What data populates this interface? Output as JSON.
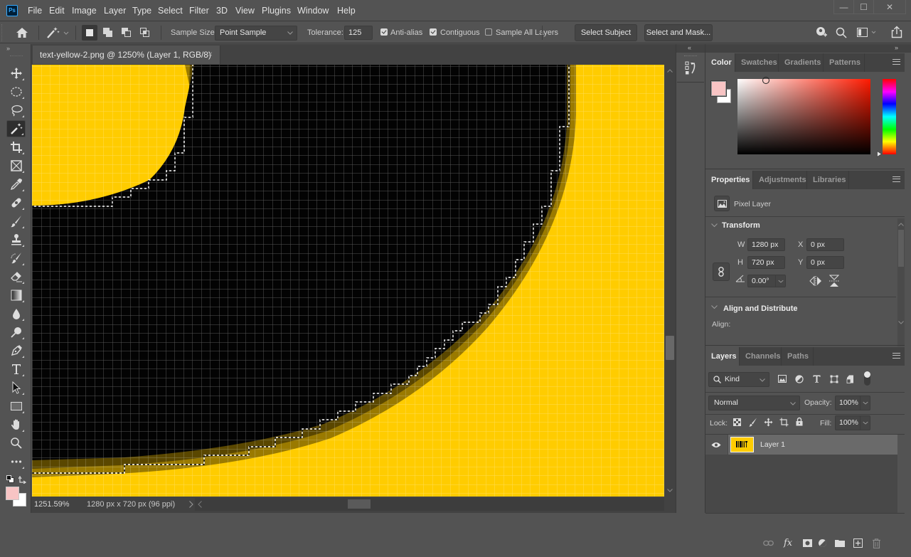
{
  "app": {
    "logo": "Ps"
  },
  "menu": [
    "File",
    "Edit",
    "Image",
    "Layer",
    "Type",
    "Select",
    "Filter",
    "3D",
    "View",
    "Plugins",
    "Window",
    "Help"
  ],
  "window_controls": {
    "minimize": "—",
    "maximize": "☐",
    "close": "✕"
  },
  "options_bar": {
    "sample_size_label": "Sample Size:",
    "sample_size_value": "Point Sample",
    "tolerance_label": "Tolerance:",
    "tolerance_value": "125",
    "anti_alias_label": "Anti-alias",
    "anti_alias_checked": true,
    "contiguous_label": "Contiguous",
    "contiguous_checked": true,
    "sample_all_layers_label": "Sample All Layers",
    "sample_all_layers_checked": false,
    "select_subject_label": "Select Subject",
    "select_and_mask_label": "Select and Mask...",
    "selection_modes": [
      "new-selection",
      "add-to-selection",
      "subtract-from-selection",
      "intersect-with-selection"
    ],
    "active_mode": "new-selection"
  },
  "document": {
    "tab_title": "text-yellow-2.png @ 1250% (Layer 1, RGB/8)",
    "close_glyph": "×",
    "zoom": "1251.59%",
    "info": "1280 px x 720 px (96 ppi)",
    "canvas_colors": {
      "yellow": "#ffcc00",
      "black": "#030303"
    }
  },
  "toolbar": {
    "tools": [
      "move",
      "marquee",
      "lasso",
      "magic-wand",
      "crop",
      "frame",
      "eyedropper",
      "healing-brush",
      "brush",
      "clone-stamp",
      "history-brush",
      "eraser",
      "gradient",
      "blur",
      "dodge",
      "pen",
      "type",
      "path-selection",
      "rectangle",
      "hand",
      "zoom",
      "more"
    ],
    "active_tool": "magic-wand",
    "foreground_color": "#f8c4c4",
    "background_color": "#ffffff"
  },
  "color_panel": {
    "tabs": [
      "Color",
      "Swatches",
      "Gradients",
      "Patterns"
    ],
    "active_tab": "Color",
    "foreground_color": "#f8c4c4",
    "background_color": "#ffffff",
    "hue": "#ff0000"
  },
  "properties_panel": {
    "tabs": [
      "Properties",
      "Adjustments",
      "Libraries"
    ],
    "active_tab": "Properties",
    "layer_type": "Pixel Layer",
    "transform_title": "Transform",
    "w_label": "W",
    "w_value": "1280 px",
    "h_label": "H",
    "h_value": "720 px",
    "x_label": "X",
    "x_value": "0 px",
    "y_label": "Y",
    "y_value": "0 px",
    "angle_value": "0.00°",
    "align_title": "Align and Distribute",
    "align_label": "Align:"
  },
  "layers_panel": {
    "tabs": [
      "Layers",
      "Channels",
      "Paths"
    ],
    "active_tab": "Layers",
    "filter_kind": "Kind",
    "blend_mode": "Normal",
    "opacity_label": "Opacity:",
    "opacity_value": "100%",
    "lock_label": "Lock:",
    "fill_label": "Fill:",
    "fill_value": "100%",
    "layers": [
      {
        "name": "Layer 1",
        "visible": true,
        "selected": true
      }
    ],
    "footer_actions": [
      "link-layers",
      "fx",
      "add-mask",
      "adjustment-layer",
      "new-group",
      "new-layer",
      "delete-layer"
    ]
  }
}
